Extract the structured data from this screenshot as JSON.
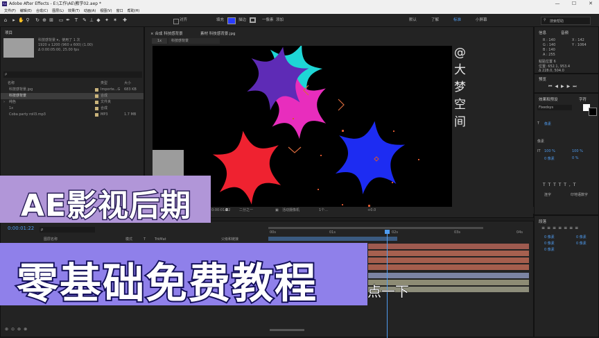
{
  "window": {
    "app_icon": "Ae",
    "title": "Adobe After Effects - E:\\工作\\AE\\教学02.aep *",
    "controls": [
      "—",
      "☐",
      "✕"
    ]
  },
  "menu": [
    "文件(F)",
    "编辑(E)",
    "合成(C)",
    "图层(L)",
    "效果(T)",
    "动画(A)",
    "视图(V)",
    "窗口",
    "帮助(H)"
  ],
  "toolbar": {
    "snap_label": "对齐",
    "fill_label": "填充",
    "stroke_label": "描边",
    "stroke_value": "一像素",
    "add_label": "添加",
    "workspaces": [
      "默认",
      "了解",
      "标准",
      "小屏幕"
    ],
    "search_placeholder": "搜索帮助"
  },
  "project": {
    "title": "项目",
    "selected_item": "科技感背景",
    "used_count": "，使用了 1 次",
    "dimensions": "1920 x 1200 (960 x 600) (1.00)",
    "duration": "Δ 0:00:05:00, 25.00 fps",
    "search_placeholder": "ρ",
    "columns": [
      "名称",
      "类型",
      "大小"
    ],
    "items": [
      {
        "name": "科技感背景.jpg",
        "type": "Importe...G",
        "size": "683 KB",
        "color": "#c9b37b"
      },
      {
        "name": "科技感背景",
        "type": "合成",
        "size": "",
        "color": "#c9b37b"
      },
      {
        "name": "纯色",
        "type": "文件夹",
        "size": "",
        "color": "#c9b37b"
      },
      {
        "name": "1x",
        "type": "合成",
        "size": "",
        "color": "#c9b37b"
      },
      {
        "name": "Coba party roll3.mp3",
        "type": "MP3",
        "size": "1.7 MB",
        "color": "#c9b37b"
      }
    ]
  },
  "composition": {
    "tab_label": "合成",
    "tab_name": "科技感背景",
    "footage_tab": "素材 科技感背景.jpg",
    "watermark": "@大梦空间",
    "view_quality": "二分之一",
    "camera": "活动摄像机",
    "views": "1个...",
    "exposure": "+0.0",
    "current_time": "0:00:01:22",
    "stars": [
      {
        "color": "#5e2bb6",
        "name": "purple-star"
      },
      {
        "color": "#1ed5d5",
        "name": "cyan-star"
      },
      {
        "color": "#e82dbd",
        "name": "magenta-star"
      },
      {
        "color": "#1d2cf2",
        "name": "blue-star"
      },
      {
        "color": "#ef2230",
        "name": "red-star"
      }
    ]
  },
  "info_panel": {
    "tabs": [
      "信息",
      "音频"
    ],
    "r": "R : 140",
    "g": "G : 140",
    "b": "B : 140",
    "a": "A : 255",
    "x": "X : 142",
    "y": "Y : 1064",
    "line1": "粘贴位置 6",
    "line2": "位置: 652.1, 953.4",
    "line3": "Δ 228.0, 504.0"
  },
  "preview_panel": {
    "title": "预览"
  },
  "char_panel": {
    "tabs": [
      "效果和预设",
      "字符"
    ],
    "font": "Fixedsys",
    "size_unit": "像素",
    "scale_h": "100 %",
    "scale_v": "100 %",
    "baseline": "0 像素",
    "tsume": "0 %",
    "ligatures": "连字",
    "hindi": "印地语数字"
  },
  "paragraph_panel": {
    "title": "段落",
    "values": [
      "0 像素",
      "0 像素",
      "0 像素",
      "0 像素",
      "0 像素"
    ]
  },
  "timeline": {
    "time": "0:00:01:22",
    "search_placeholder": "ρ",
    "columns": [
      "图层名称",
      "模式",
      "T",
      "TrkMat",
      "父级和链接"
    ],
    "ruler": [
      "00s",
      "01s",
      "02s",
      "03s",
      "04s"
    ],
    "tracks": [
      {
        "color": "#9e5a4f"
      },
      {
        "color": "#a6604f"
      },
      {
        "color": "#a55e4d"
      },
      {
        "color": "#7c84a3"
      },
      {
        "color": "#8d8b74"
      },
      {
        "color": "#8d8d7a"
      }
    ]
  },
  "subtitle": "点一下",
  "banners": {
    "top": "AE影视后期",
    "bottom": "零基础免费教程"
  }
}
